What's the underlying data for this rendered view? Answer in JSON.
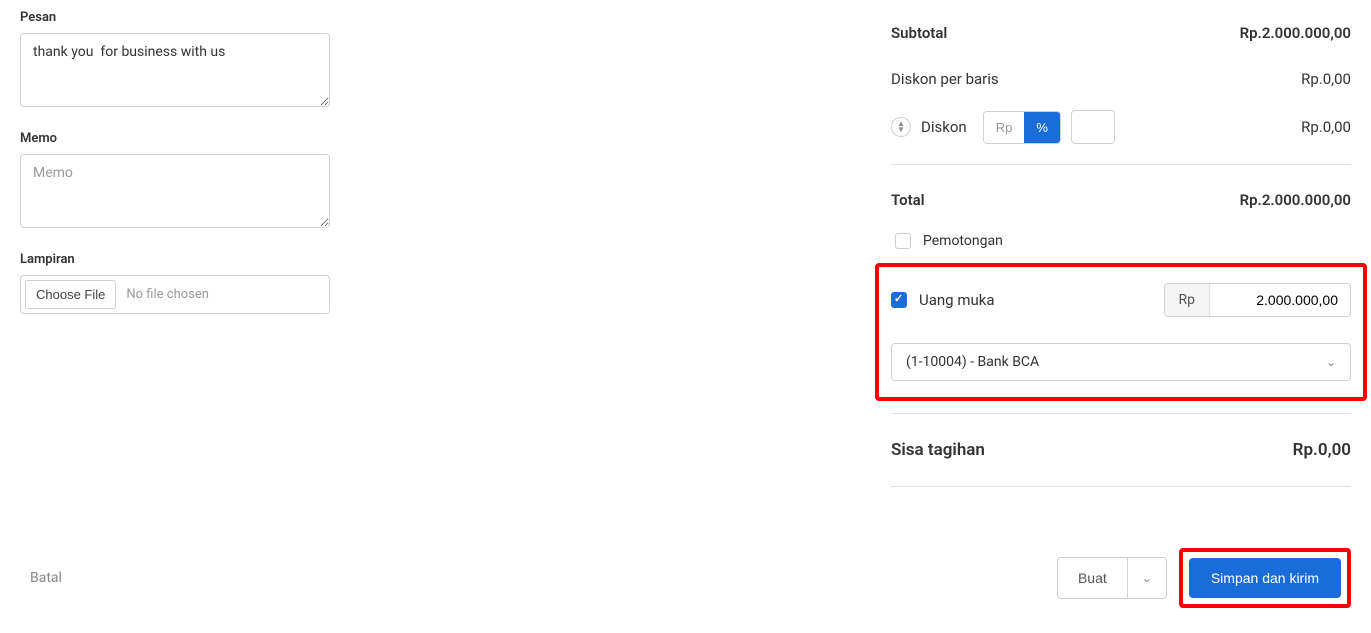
{
  "left": {
    "pesan_label": "Pesan",
    "pesan_value": "thank you  for business with us",
    "memo_label": "Memo",
    "memo_placeholder": "Memo",
    "memo_value": "",
    "lampiran_label": "Lampiran",
    "choose_file_label": "Choose File",
    "file_status": "No file chosen"
  },
  "summary": {
    "subtotal_label": "Subtotal",
    "subtotal_value": "Rp.2.000.000,00",
    "diskon_baris_label": "Diskon per baris",
    "diskon_baris_value": "Rp.0,00",
    "diskon_label": "Diskon",
    "diskon_rp": "Rp",
    "diskon_percent": "%",
    "diskon_value": "Rp.0,00",
    "total_label": "Total",
    "total_value": "Rp.2.000.000,00",
    "pemotongan_label": "Pemotongan",
    "uang_muka_label": "Uang muka",
    "uang_muka_prefix": "Rp",
    "uang_muka_value": "2.000.000,00",
    "bank_selected": "(1-10004) - Bank BCA",
    "sisa_label": "Sisa tagihan",
    "sisa_value": "Rp.0,00"
  },
  "footer": {
    "batal": "Batal",
    "buat": "Buat",
    "simpan": "Simpan dan kirim"
  }
}
